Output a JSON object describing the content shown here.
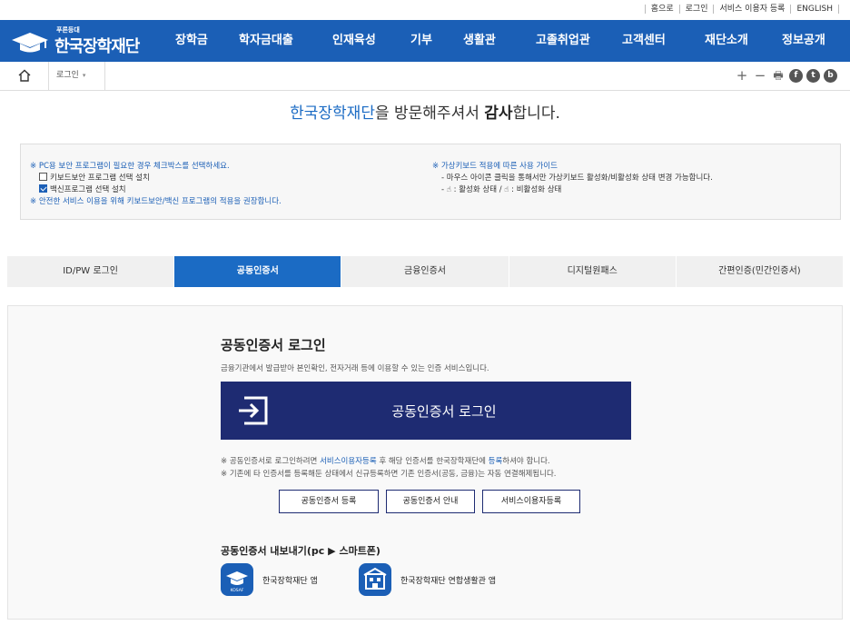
{
  "utility": [
    "홈으로",
    "로그인",
    "서비스 이용자 등록",
    "ENGLISH"
  ],
  "logo": {
    "small": "푸른등대",
    "name": "한국장학재단"
  },
  "gnb": [
    "장학금",
    "학자금대출",
    "인재육성",
    "기부",
    "생활관",
    "고졸취업관",
    "고객센터",
    "재단소개",
    "정보공개"
  ],
  "breadcrumb": {
    "current": "로그인",
    "arrow": "▾"
  },
  "tools": {
    "plus": "+",
    "minus": "−",
    "print": "🖶",
    "facebook": "f",
    "twitter": "t",
    "blog": "b"
  },
  "greeting": {
    "org": "한국장학재단",
    "mid": "을 방문해주셔서 ",
    "bold": "감사",
    "end": "합니다."
  },
  "notice": {
    "left_title": "※ PC용 보안 프로그램이 필요한 경우 체크박스를 선택하세요.",
    "opt1": "키보드보안 프로그램 선택 설치",
    "opt1_checked": false,
    "opt2": "백신프로그램 선택 설치",
    "opt2_checked": true,
    "left_footer": "※ 안전한 서비스 이용을 위해 키보드보안/백신 프로그램의 적용을 권장합니다.",
    "right_title": "※ 가상키보드 적용에 따른 사용 가이드",
    "right_line1": "- 마우스 아이콘 클릭을 통해서만 가상키보드 활성화/비활성화 상태 변경 가능합니다.",
    "right_line2": "- ☝ : 활성화 상태 / ☝ : 비활성화 상태"
  },
  "tabs": [
    "ID/PW 로그인",
    "공동인증서",
    "금융인증서",
    "디지털원패스",
    "간편인증(민간인증서)"
  ],
  "active_tab": 1,
  "content": {
    "title": "공동인증서 로그인",
    "desc": "금융기관에서 발급받아 본인확인, 전자거래 등에 이용할 수 있는 인증 서비스입니다.",
    "login_button": "공동인증서 로그인",
    "note1_a": "※ 공동인증서로 로그인하려면 ",
    "note1_link": "서비스이용자등록",
    "note1_b": " 후 해당 인증서를 한국장학재단에 ",
    "note1_link2": "등록",
    "note1_c": "하셔야 합니다.",
    "note2": "※ 기존에 타 인증서를 등록해둔 상태에서 신규등록하면 기존 인증서(공동, 금융)는 자동 연결해제됩니다.",
    "buttons": [
      "공동인증서 등록",
      "공동인증서 안내",
      "서비스이용자등록"
    ],
    "export_title": "공동인증서 내보내기(pc ▶ 스마트폰)",
    "apps": [
      {
        "label": "한국장학재단 앱",
        "badge": "KOSAF"
      },
      {
        "label": "한국장학재단 연합생활관 앱",
        "badge": ""
      }
    ]
  }
}
